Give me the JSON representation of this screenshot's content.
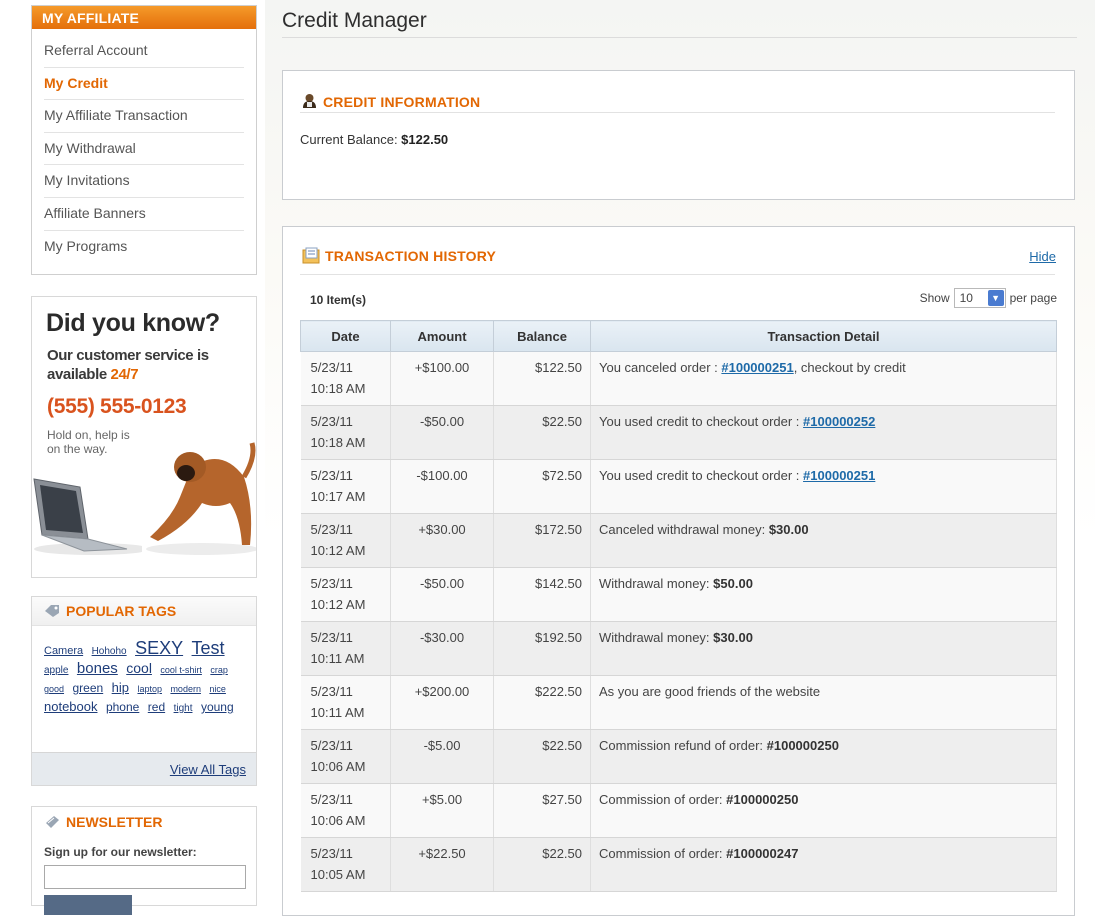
{
  "sidebar": {
    "affiliate_title": "MY AFFILIATE",
    "menu": [
      {
        "label": "Referral Account"
      },
      {
        "label": "My Credit"
      },
      {
        "label": "My Affiliate Transaction"
      },
      {
        "label": "My Withdrawal"
      },
      {
        "label": "My Invitations"
      },
      {
        "label": "Affiliate Banners"
      },
      {
        "label": "My Programs"
      }
    ],
    "active_index": 1,
    "promo": {
      "title": "Did you know?",
      "line1": "Our customer service is",
      "line2_prefix": "available ",
      "line2_highlight": "24/7",
      "phone": "(555) 555-0123",
      "small1": "Hold on, help is",
      "small2": "on the way."
    },
    "tags": {
      "title": "POPULAR TAGS",
      "items": [
        {
          "label": "Camera",
          "size": 11
        },
        {
          "label": "Hohoho",
          "size": 10
        },
        {
          "label": "SEXY",
          "size": 18
        },
        {
          "label": "Test",
          "size": 18
        },
        {
          "label": "apple",
          "size": 10
        },
        {
          "label": "bones",
          "size": 15
        },
        {
          "label": "cool",
          "size": 14
        },
        {
          "label": "cool t-shirt",
          "size": 9
        },
        {
          "label": "crap",
          "size": 9
        },
        {
          "label": "good",
          "size": 9
        },
        {
          "label": "green",
          "size": 12
        },
        {
          "label": "hip",
          "size": 13
        },
        {
          "label": "laptop",
          "size": 9
        },
        {
          "label": "modern",
          "size": 9
        },
        {
          "label": "nice",
          "size": 9
        },
        {
          "label": "notebook",
          "size": 13
        },
        {
          "label": "phone",
          "size": 12
        },
        {
          "label": "red",
          "size": 12
        },
        {
          "label": "tight",
          "size": 10
        },
        {
          "label": "young",
          "size": 12
        }
      ],
      "view_all": "View All Tags"
    },
    "newsletter": {
      "title": "NEWSLETTER",
      "label": "Sign up for our newsletter:"
    }
  },
  "main": {
    "title": "Credit Manager",
    "credit": {
      "heading": "CREDIT INFORMATION",
      "balance_label": "Current Balance: ",
      "balance_value": "$122.50"
    },
    "history": {
      "heading": "TRANSACTION HISTORY",
      "hide": "Hide",
      "items": "10 Item(s)",
      "show": "Show",
      "per_page_value": "10",
      "per_page": "per page",
      "columns": [
        "Date",
        "Amount",
        "Balance",
        "Transaction Detail"
      ],
      "rows": [
        {
          "date": "5/23/11",
          "time": "10:18 AM",
          "amount": "+$100.00",
          "balance": "$122.50",
          "detail_text": "You canceled order : ",
          "detail_link": "#100000251",
          "detail_suffix": ", checkout by credit",
          "detail_bold": ""
        },
        {
          "date": "5/23/11",
          "time": "10:18 AM",
          "amount": "-$50.00",
          "balance": "$22.50",
          "detail_text": "You used credit to checkout order : ",
          "detail_link": "#100000252",
          "detail_suffix": "",
          "detail_bold": ""
        },
        {
          "date": "5/23/11",
          "time": "10:17 AM",
          "amount": "-$100.00",
          "balance": "$72.50",
          "detail_text": "You used credit to checkout order : ",
          "detail_link": "#100000251",
          "detail_suffix": "",
          "detail_bold": ""
        },
        {
          "date": "5/23/11",
          "time": "10:12 AM",
          "amount": "+$30.00",
          "balance": "$172.50",
          "detail_text": "Canceled withdrawal money: ",
          "detail_link": "",
          "detail_suffix": "",
          "detail_bold": "$30.00"
        },
        {
          "date": "5/23/11",
          "time": "10:12 AM",
          "amount": "-$50.00",
          "balance": "$142.50",
          "detail_text": "Withdrawal money: ",
          "detail_link": "",
          "detail_suffix": "",
          "detail_bold": "$50.00"
        },
        {
          "date": "5/23/11",
          "time": "10:11 AM",
          "amount": "-$30.00",
          "balance": "$192.50",
          "detail_text": "Withdrawal money: ",
          "detail_link": "",
          "detail_suffix": "",
          "detail_bold": "$30.00"
        },
        {
          "date": "5/23/11",
          "time": "10:11 AM",
          "amount": "+$200.00",
          "balance": "$222.50",
          "detail_text": "As you are good friends of the website",
          "detail_link": "",
          "detail_suffix": "",
          "detail_bold": ""
        },
        {
          "date": "5/23/11",
          "time": "10:06 AM",
          "amount": "-$5.00",
          "balance": "$22.50",
          "detail_text": "Commission refund of order: ",
          "detail_link": "",
          "detail_suffix": "",
          "detail_bold": "#100000250"
        },
        {
          "date": "5/23/11",
          "time": "10:06 AM",
          "amount": "+$5.00",
          "balance": "$27.50",
          "detail_text": "Commission of order: ",
          "detail_link": "",
          "detail_suffix": "",
          "detail_bold": "#100000250"
        },
        {
          "date": "5/23/11",
          "time": "10:05 AM",
          "amount": "+$22.50",
          "balance": "$22.50",
          "detail_text": "Commission of order: ",
          "detail_link": "",
          "detail_suffix": "",
          "detail_bold": "#100000247"
        }
      ]
    }
  },
  "colors": {
    "accent_orange": "#e26703",
    "link_blue": "#1e6aa8"
  }
}
